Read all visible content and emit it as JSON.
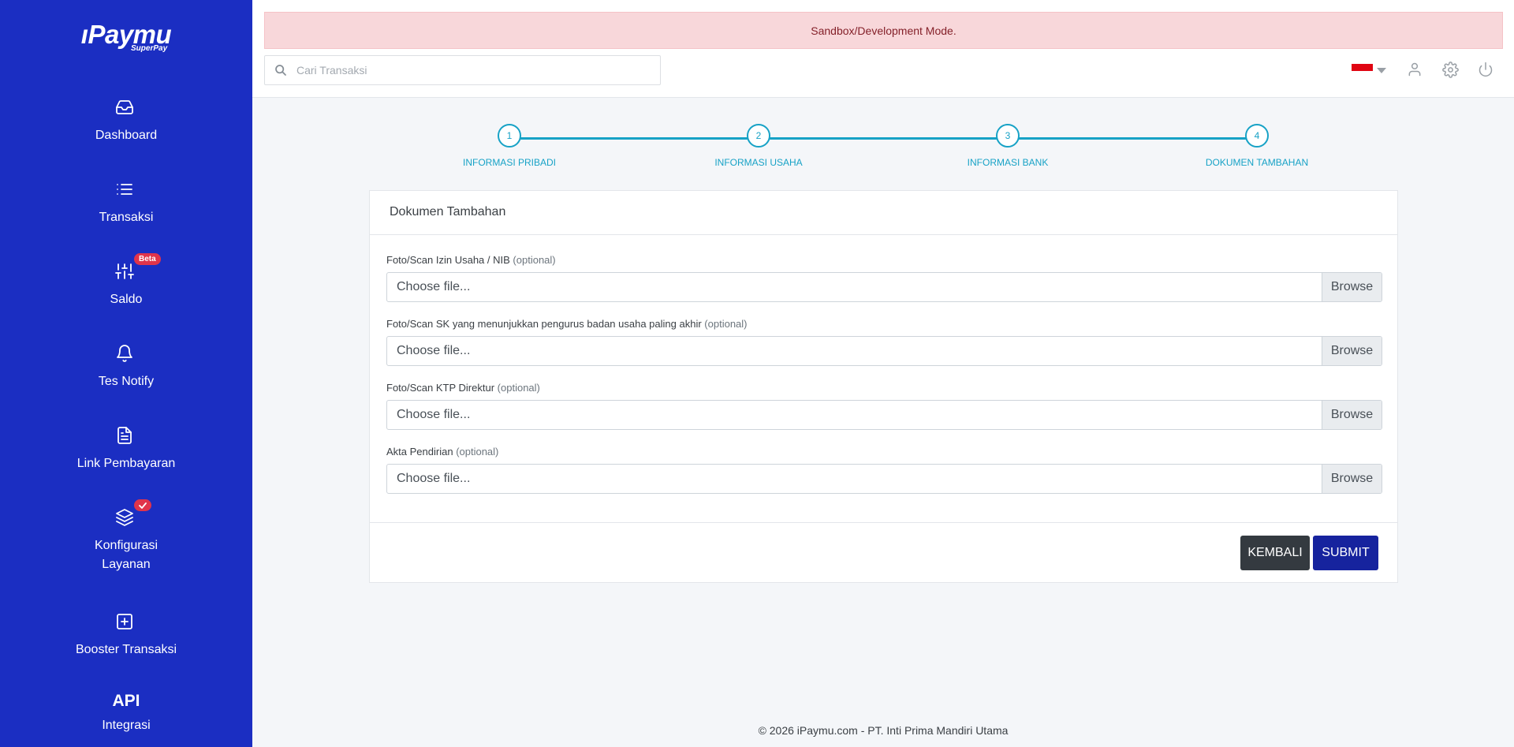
{
  "sidebar": {
    "logo": "ıPaymu",
    "logo_sub": "SuperPay",
    "items": [
      {
        "label": "Dashboard",
        "icon": "inbox-icon"
      },
      {
        "label": "Transaksi",
        "icon": "list-icon"
      },
      {
        "label": "Saldo",
        "icon": "sliders-icon",
        "badge": "Beta"
      },
      {
        "label": "Tes Notify",
        "icon": "bell-icon"
      },
      {
        "label": "Link Pembayaran",
        "icon": "document-icon"
      },
      {
        "label": "Konfigurasi Layanan",
        "icon": "layers-icon",
        "badge": "check"
      },
      {
        "label": "Booster Transaksi",
        "icon": "plus-square-icon"
      },
      {
        "label": "Integrasi",
        "icon_text": "API"
      }
    ]
  },
  "header": {
    "alert": "Sandbox/Development Mode.",
    "search_placeholder": "Cari Transaksi",
    "flag": "Indonesia",
    "icons": [
      "user-icon",
      "gear-icon",
      "power-icon"
    ]
  },
  "stepper": {
    "steps": [
      {
        "number": "1",
        "label": "INFORMASI PRIBADI"
      },
      {
        "number": "2",
        "label": "INFORMASI USAHA"
      },
      {
        "number": "3",
        "label": "INFORMASI BANK"
      },
      {
        "number": "4",
        "label": "DOKUMEN TAMBAHAN"
      }
    ],
    "accent": "#17a2c6"
  },
  "form": {
    "title": "Dokumen Tambahan",
    "fields": [
      {
        "label": "Foto/Scan Izin Usaha / NIB",
        "note": "(optional)",
        "value": "Choose file...",
        "button": "Browse"
      },
      {
        "label": "Foto/Scan SK yang menunjukkan pengurus badan usaha paling akhir",
        "note": "(optional)",
        "value": "Choose file...",
        "button": "Browse"
      },
      {
        "label": "Foto/Scan KTP Direktur",
        "note": "(optional)",
        "value": "Choose file...",
        "button": "Browse"
      },
      {
        "label": "Akta Pendirian",
        "note": "(optional)",
        "value": "Choose file...",
        "button": "Browse"
      }
    ],
    "back_label": "KEMBALI",
    "submit_label": "SUBMIT"
  },
  "footer": "© 2026 iPaymu.com - PT. Inti Prima Mandiri Utama",
  "colors": {
    "sidebar": "#1b2ec2",
    "alert_bg": "#f8d7da",
    "alert_text": "#842029",
    "submit": "#16239e",
    "back": "#343a40",
    "badge": "#e0344b"
  }
}
